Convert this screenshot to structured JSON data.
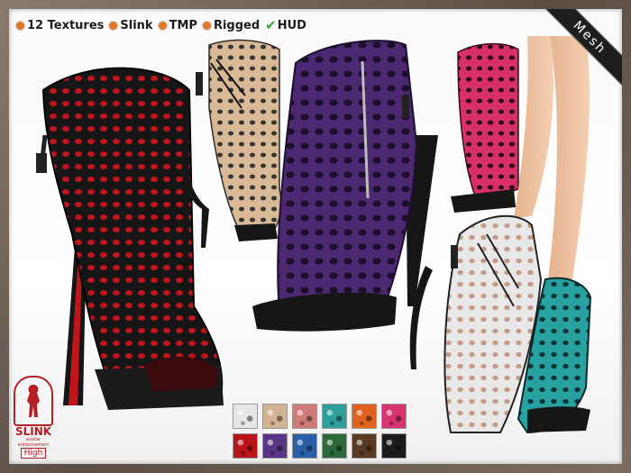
{
  "features": [
    {
      "label": "12 Textures",
      "marker": "orange-dot"
    },
    {
      "label": "Slink",
      "marker": "orange-dot"
    },
    {
      "label": "TMP",
      "marker": "orange-dot"
    },
    {
      "label": "Rigged",
      "marker": "orange-dot"
    },
    {
      "label": "HUD",
      "marker": "check-icon"
    }
  ],
  "ribbon": "Mesh",
  "logo": {
    "brand": "SLINK",
    "sub": "avatar enhancement",
    "tier": "High"
  },
  "colors": {
    "marker": "#e1772a",
    "check": "#3aa236",
    "logo": "#b21f24",
    "shoes": {
      "black": "#161616",
      "red-sole": "#c0161b",
      "nude": "#d9b896",
      "purple": "#4b2870",
      "pink": "#d62f6a",
      "white": "#e8e8e8",
      "teal": "#27a2a0"
    }
  },
  "swatches": [
    {
      "name": "white",
      "color": "#e6e6e6"
    },
    {
      "name": "nude",
      "color": "#d4b393"
    },
    {
      "name": "rose",
      "color": "#d27a78"
    },
    {
      "name": "teal",
      "color": "#2e9f9c"
    },
    {
      "name": "orange",
      "color": "#e0621e"
    },
    {
      "name": "pink",
      "color": "#d83472"
    },
    {
      "name": "red",
      "color": "#b8141a"
    },
    {
      "name": "purple",
      "color": "#5a3585"
    },
    {
      "name": "blue",
      "color": "#2a5fa8"
    },
    {
      "name": "green",
      "color": "#2d6a3a"
    },
    {
      "name": "brown",
      "color": "#5b3a22"
    },
    {
      "name": "black",
      "color": "#1c1c1c"
    }
  ]
}
